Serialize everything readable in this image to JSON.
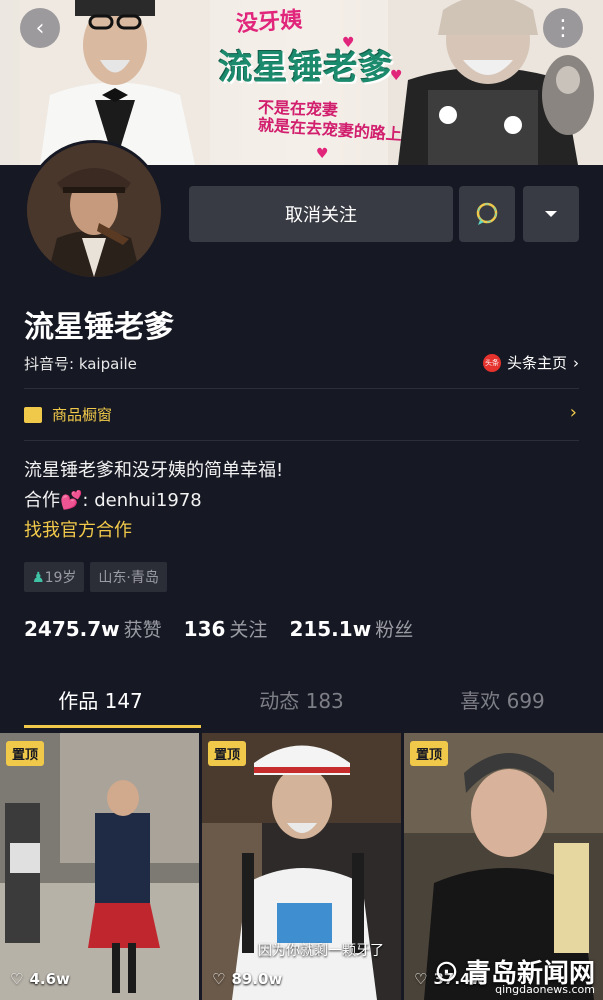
{
  "banner": {
    "small_title": "没牙姨",
    "title": "流星锤老爹",
    "line1": "不是在宠妻",
    "line2": "就是在去宠妻的路上"
  },
  "top_actions": {
    "back_icon": "chevron-left-icon",
    "more_icon": "ellipsis-vertical-icon"
  },
  "profile": {
    "name": "流星锤老爹",
    "douyin_id": "抖音号: kaipaile",
    "toutiao_label": "头条主页",
    "toutiao_logo_text": "头条"
  },
  "actions": {
    "unfollow_label": "取消关注",
    "message_icon": "chat-bubble-icon",
    "dropdown_icon": "caret-down-icon"
  },
  "shop": {
    "label": "商品橱窗",
    "icon": "shop-bag-icon"
  },
  "bio": {
    "line1": "流星锤老爹和没牙姨的简单幸福!",
    "line2_prefix": "合作",
    "line2_suffix": ": denhui1978",
    "line3": "找我官方合作"
  },
  "tags": {
    "age": "19岁",
    "location": "山东·青岛"
  },
  "stats": {
    "likes_value": "2475.7w",
    "likes_label": "获赞",
    "following_value": "136",
    "following_label": "关注",
    "followers_value": "215.1w",
    "followers_label": "粉丝"
  },
  "tabs": [
    {
      "label": "作品 147",
      "active": true
    },
    {
      "label": "动态 183",
      "active": false
    },
    {
      "label": "喜欢 699",
      "active": false
    }
  ],
  "videos": [
    {
      "pin": "置顶",
      "likes": "4.6w"
    },
    {
      "pin": "置顶",
      "likes": "89.0w",
      "caption": "因为你就剩一颗牙了"
    },
    {
      "pin": "置顶",
      "likes": "37.4w"
    }
  ],
  "watermark": {
    "text": "青岛新闻网",
    "url": "qingdaonews.com"
  },
  "colors": {
    "background": "#161823",
    "button": "#393b44",
    "accent_yellow": "#f1c94a",
    "gray_text": "#9a9ba3"
  }
}
